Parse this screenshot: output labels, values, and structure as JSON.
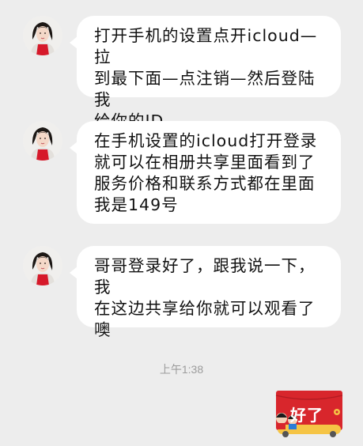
{
  "messages": [
    {
      "text": "打开手机的设置点开icloud—拉\n到最下面—点注销—然后登陆我\n给你的ID。"
    },
    {
      "text": "在手机设置的icloud打开登录\n就可以在相册共享里面看到了\n服务价格和联系方式都在里面\n我是149号"
    },
    {
      "text": "哥哥登录好了，跟我说一下，我\n在这边共享给你就可以观看了\n噢"
    }
  ],
  "timestamp": "上午1:38",
  "reply_sticker": {
    "text": "好了",
    "color": "#d8262c"
  },
  "colors": {
    "background": "#ededed",
    "bubble": "#ffffff",
    "timestamp": "#9c9c9c"
  }
}
